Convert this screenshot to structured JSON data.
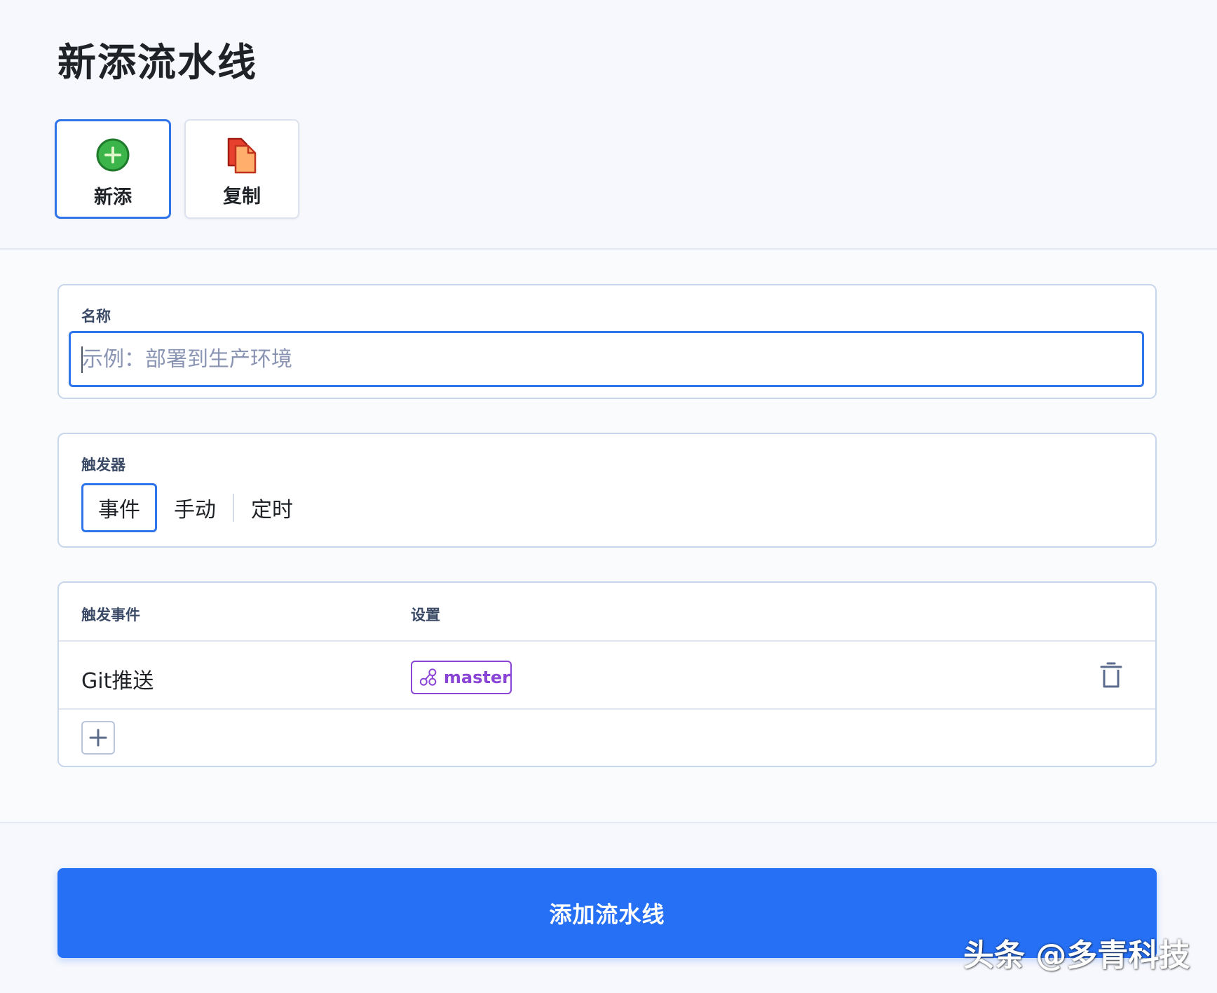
{
  "page": {
    "title": "新添流水线"
  },
  "modes": {
    "new_label": "新添",
    "copy_label": "复制",
    "selected": "新添"
  },
  "name_field": {
    "label": "名称",
    "value": "",
    "placeholder": "示例：部署到生产环境"
  },
  "trigger": {
    "label": "触发器",
    "options": [
      "事件",
      "手动",
      "定时"
    ],
    "selected": "事件"
  },
  "events_table": {
    "headers": {
      "event": "触发事件",
      "settings": "设置"
    },
    "rows": [
      {
        "event": "Git推送",
        "branch": "master",
        "branch_icon": "git-branch-icon",
        "delete_icon": "trash-icon"
      }
    ],
    "add_icon": "plus-icon"
  },
  "submit": {
    "label": "添加流水线"
  },
  "watermark": {
    "text": "头条 @多青科技"
  },
  "colors": {
    "accent": "#2f74e8",
    "submit_bg": "#2670f5",
    "branch": "#8b45d6",
    "add_icon_bg": "#3bb44a",
    "copy_icon": "#f26b3a"
  }
}
